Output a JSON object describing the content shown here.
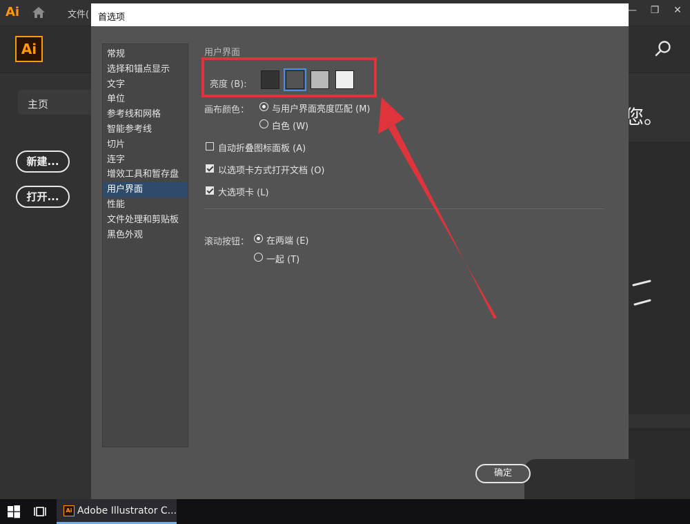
{
  "app": {
    "logo_small": "Ai",
    "menu_file": "文件(",
    "logo": "Ai",
    "home_label": "主页",
    "new_button": "新建...",
    "open_button": "打开...",
    "welcome_partial": "您。"
  },
  "dialog": {
    "title": "首选项",
    "categories": [
      {
        "label": "常规"
      },
      {
        "label": "选择和锚点显示"
      },
      {
        "label": "文字"
      },
      {
        "label": "单位"
      },
      {
        "label": "参考线和网格"
      },
      {
        "label": "智能参考线"
      },
      {
        "label": "切片"
      },
      {
        "label": "连字"
      },
      {
        "label": "增效工具和暂存盘"
      },
      {
        "label": "用户界面",
        "active": true
      },
      {
        "label": "性能"
      },
      {
        "label": "文件处理和剪贴板"
      },
      {
        "label": "黑色外观"
      }
    ],
    "section_title": "用户界面",
    "brightness_label": "亮度 (B):",
    "brightness_swatches": [
      "#323232",
      "#535353",
      "#b8b8b8",
      "#f0f0f0"
    ],
    "brightness_selected_index": 1,
    "canvas_color_label": "画布颜色：",
    "canvas_options": [
      {
        "label": "与用户界面亮度匹配 (M)",
        "selected": true
      },
      {
        "label": "白色 (W)",
        "selected": false
      }
    ],
    "checkboxes": [
      {
        "label": "自动折叠图标面板 (A)",
        "checked": false
      },
      {
        "label": "以选项卡方式打开文档 (O)",
        "checked": true
      },
      {
        "label": "大选项卡 (L)",
        "checked": true
      }
    ],
    "scroll_label": "滚动按钮：",
    "scroll_options": [
      {
        "label": "在两端 (E)",
        "selected": true
      },
      {
        "label": "一起 (T)",
        "selected": false
      }
    ],
    "ok_button": "确定"
  },
  "taskbar": {
    "task_icon": "Ai",
    "task_label": "Adobe Illustrator C..."
  },
  "colors": {
    "highlight": "#e0343c",
    "accent": "#ff9a00",
    "selection": "#2f4b6c"
  }
}
